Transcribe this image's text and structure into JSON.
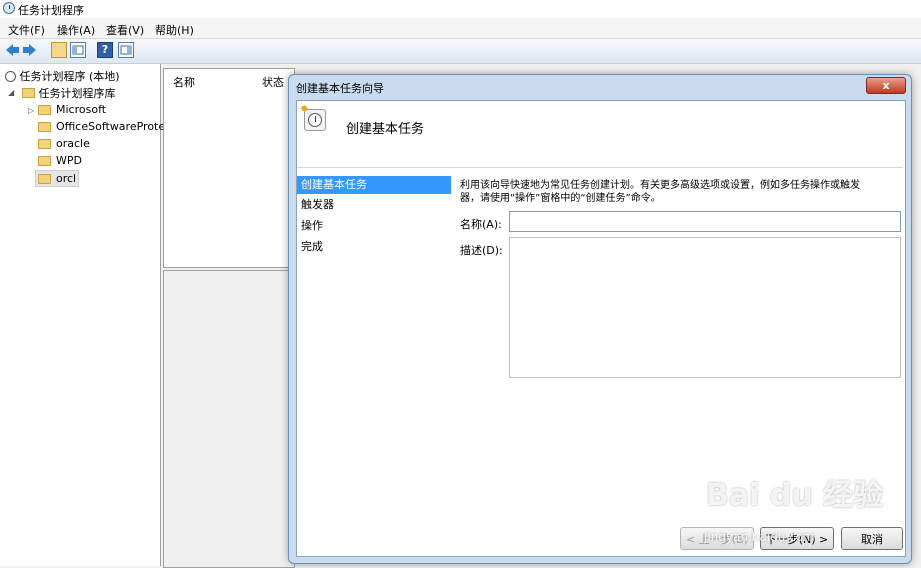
{
  "window": {
    "title": "任务计划程序"
  },
  "menu": [
    "文件(F)",
    "操作(A)",
    "查看(V)",
    "帮助(H)"
  ],
  "tree": {
    "root": "任务计划程序 (本地)",
    "library": "任务计划程序库",
    "folders": [
      "Microsoft",
      "OfficeSoftwareProte",
      "oracle",
      "WPD",
      "orcl"
    ]
  },
  "middle": {
    "columns": [
      "名称",
      "状态"
    ]
  },
  "wizard": {
    "dialog_title": "创建基本任务向导",
    "close_label": "x",
    "header_title": "创建基本任务",
    "steps": [
      "创建基本任务",
      "触发器",
      "操作",
      "完成"
    ],
    "description_line1": "利用该向导快速地为常见任务创建计划。有关更多高级选项或设置，例如多任务操作或触发",
    "description_line2": "器，请使用“操作”窗格中的“创建任务”命令。",
    "name_label": "名称(A):",
    "name_value": "",
    "desc_label": "描述(D):",
    "desc_value": "",
    "buttons": {
      "back": "< 上一步(B)",
      "next": "下一步(N) >",
      "cancel": "取消"
    }
  },
  "watermark": {
    "brand": "Bai du 经验",
    "url": "jingyan.baidu.com"
  }
}
